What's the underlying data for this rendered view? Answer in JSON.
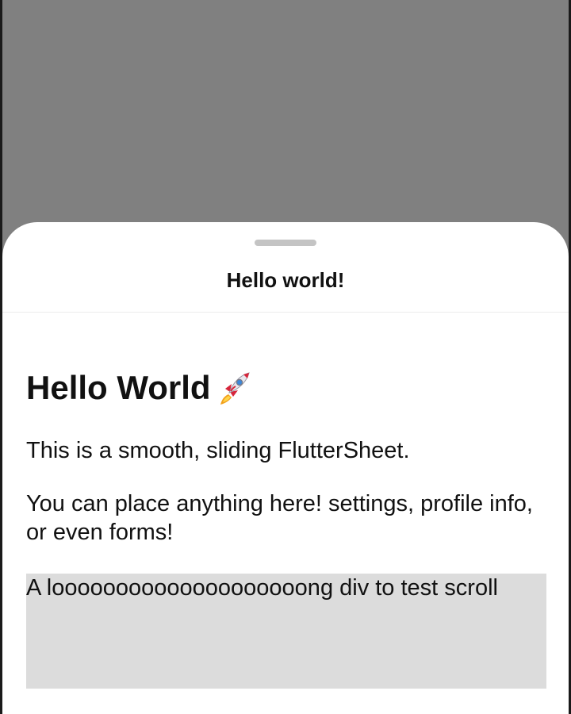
{
  "sheet": {
    "title": "Hello world!",
    "heading": "Hello World",
    "heading_icon": "rocket-icon",
    "paragraph_1": "This is a smooth, sliding FlutterSheet.",
    "paragraph_2": "You can place anything here! settings, profile info, or even forms!",
    "scroll_box_text": "A loooooooooooooooooooong div to test scroll"
  },
  "colors": {
    "backdrop": "#808080",
    "sheet_background": "#ffffff",
    "handle": "#c4c4c4",
    "scroll_box": "#dcdcdc",
    "text": "#111111"
  }
}
